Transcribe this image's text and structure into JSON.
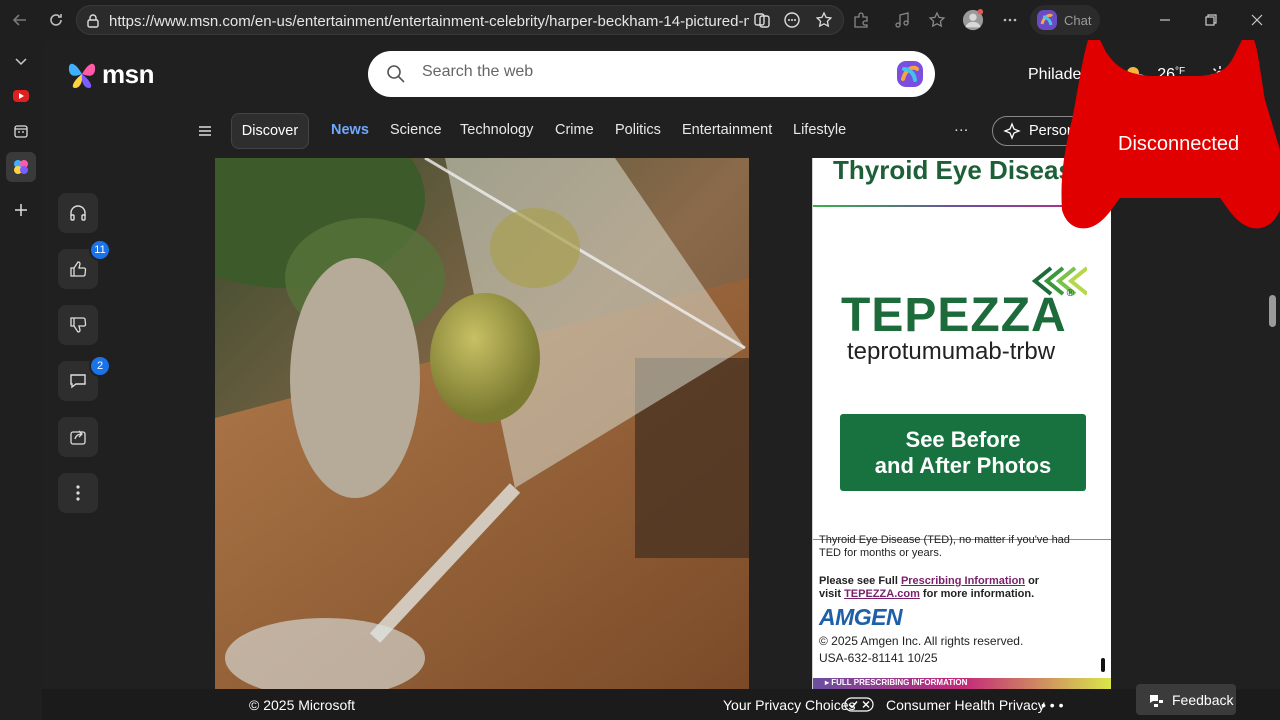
{
  "browser": {
    "url": "https://www.msn.com/en-us/entertainment/entertainment-celebrity/harper-beckham-14-pictured-m...",
    "chat_label": "Chat"
  },
  "header": {
    "logo_text": "msn",
    "search_placeholder": "Search the web",
    "weather_city": "Philadelphia",
    "weather_temp": "26",
    "weather_unit": "°F"
  },
  "nav": {
    "discover": "Discover",
    "items": [
      "News",
      "Science",
      "Technology",
      "Crime",
      "Politics",
      "Entertainment",
      "Lifestyle"
    ],
    "active": "News",
    "more": "···",
    "personal": "Personalize"
  },
  "rail": {
    "like_count": "11",
    "comment_count": "2"
  },
  "ad": {
    "headline": "Thyroid Eye Disease",
    "brand": "TEPEZZA",
    "brand_reg": "®",
    "generic": "teprotumumab-trbw",
    "cta_line1": "See Before",
    "cta_line2": "and After Photos",
    "body_line1": "Thyroid Eye Disease (TED), no matter if you've had",
    "body_line2": "TED for months or years.",
    "pi_prefix": "Please see Full ",
    "pi_link": "Prescribing Information",
    "pi_or": " or",
    "visit_prefix": "visit ",
    "visit_link": "TEPEZZA.com",
    "visit_suffix": " for more information.",
    "amgen": "AMGEN",
    "copyright": "© 2025 Amgen Inc. All rights reserved.",
    "code": "USA-632-81141 10/25",
    "pi_bar": "▸ FULL PRESCRIBING INFORMATION"
  },
  "overlay": {
    "status": "Disconnected",
    "color": "#e00000"
  },
  "footer": {
    "copyright": "© 2025 Microsoft",
    "privacy_choices": "Your Privacy Choices",
    "consumer_health": "Consumer Health Privacy",
    "more": "• • •",
    "feedback": "Feedback"
  }
}
